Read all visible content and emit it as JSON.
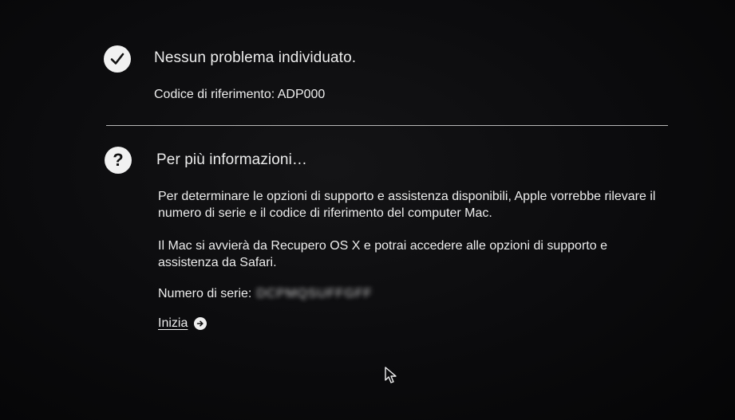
{
  "result": {
    "icon": "checkmark-circle-icon",
    "title": "Nessun problema individuato.",
    "reference_code": "Codice di riferimento: ADP000"
  },
  "info": {
    "icon": "question-circle-icon",
    "title": "Per più informazioni…",
    "paragraph_1": "Per determinare le opzioni di supporto e assistenza disponibili, Apple vorrebbe rilevare il numero di serie e il codice di riferimento del computer Mac.",
    "paragraph_2": "Il Mac si avvierà da Recupero OS X e potrai accedere alle opzioni di supporto e assistenza da Safari.",
    "serial_label": "Numero di serie:",
    "serial_value": "DCPMQSUFFGFF",
    "start_link": "Inizia",
    "start_icon": "arrow-right-circle-icon"
  },
  "cursor": "mouse-pointer-icon"
}
